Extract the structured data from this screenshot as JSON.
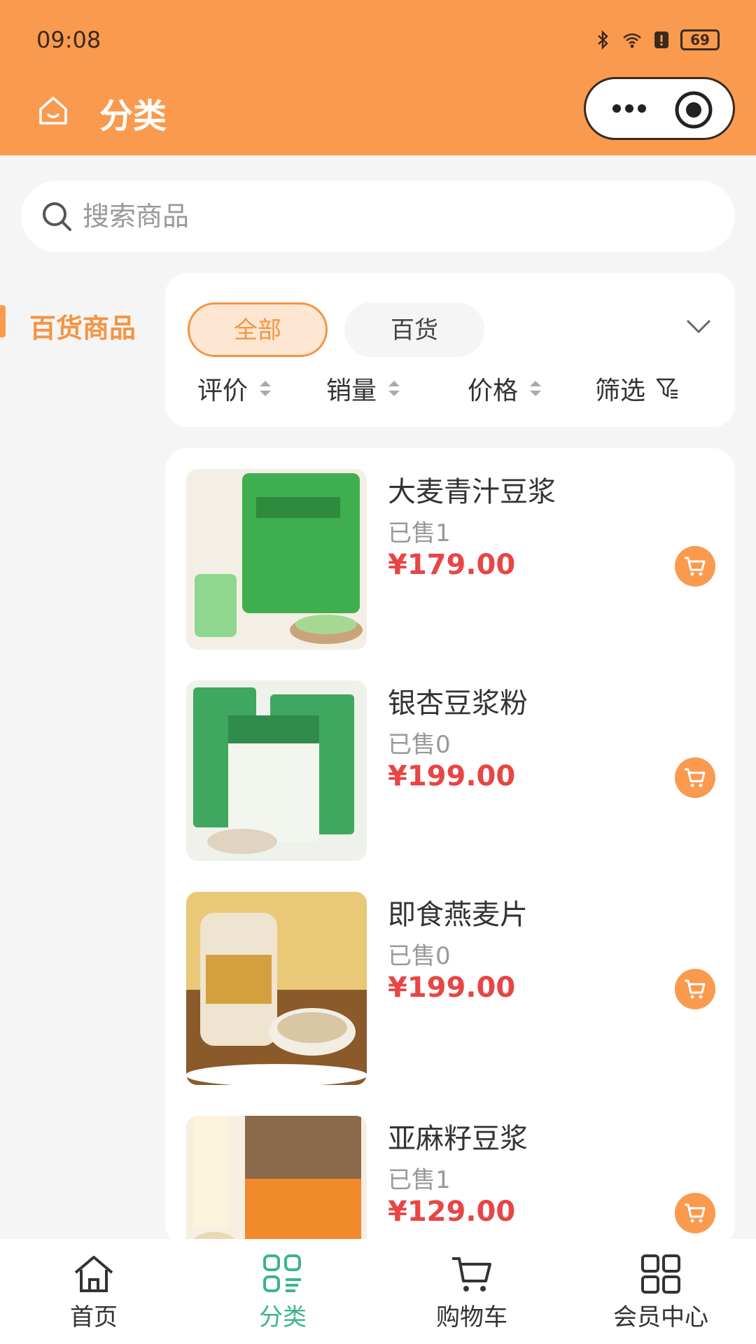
{
  "status_bar": {
    "time": "09:08",
    "battery": "69"
  },
  "nav": {
    "title": "分类"
  },
  "search": {
    "placeholder": "搜索商品"
  },
  "sidebar": {
    "items": [
      {
        "label": "百货商品",
        "active": true
      }
    ]
  },
  "filters": {
    "chips": [
      {
        "label": "全部",
        "active": true
      },
      {
        "label": "百货",
        "active": false
      }
    ],
    "sort": [
      {
        "label": "评价"
      },
      {
        "label": "销量"
      },
      {
        "label": "价格"
      },
      {
        "label": "筛选"
      }
    ]
  },
  "products": [
    {
      "name": "大麦青汁豆浆",
      "sold": "已售1",
      "price": "¥179.00",
      "color": "#4bb35a"
    },
    {
      "name": "银杏豆浆粉",
      "sold": "已售0",
      "price": "¥199.00",
      "color": "#3fa760"
    },
    {
      "name": "即食燕麦片",
      "sold": "已售0",
      "price": "¥199.00",
      "color": "#d9a14a"
    },
    {
      "name": "亚麻籽豆浆",
      "sold": "已售1",
      "price": "¥129.00",
      "color": "#f08a2a"
    }
  ],
  "tabbar": {
    "items": [
      {
        "label": "首页",
        "icon": "home-icon"
      },
      {
        "label": "分类",
        "icon": "category-icon",
        "active": true
      },
      {
        "label": "购物车",
        "icon": "cart-icon"
      },
      {
        "label": "会员中心",
        "icon": "member-grid-icon"
      }
    ]
  },
  "colors": {
    "brand": "#fa9a4e",
    "price": "#e84545",
    "tab_active": "#3bb58a"
  }
}
